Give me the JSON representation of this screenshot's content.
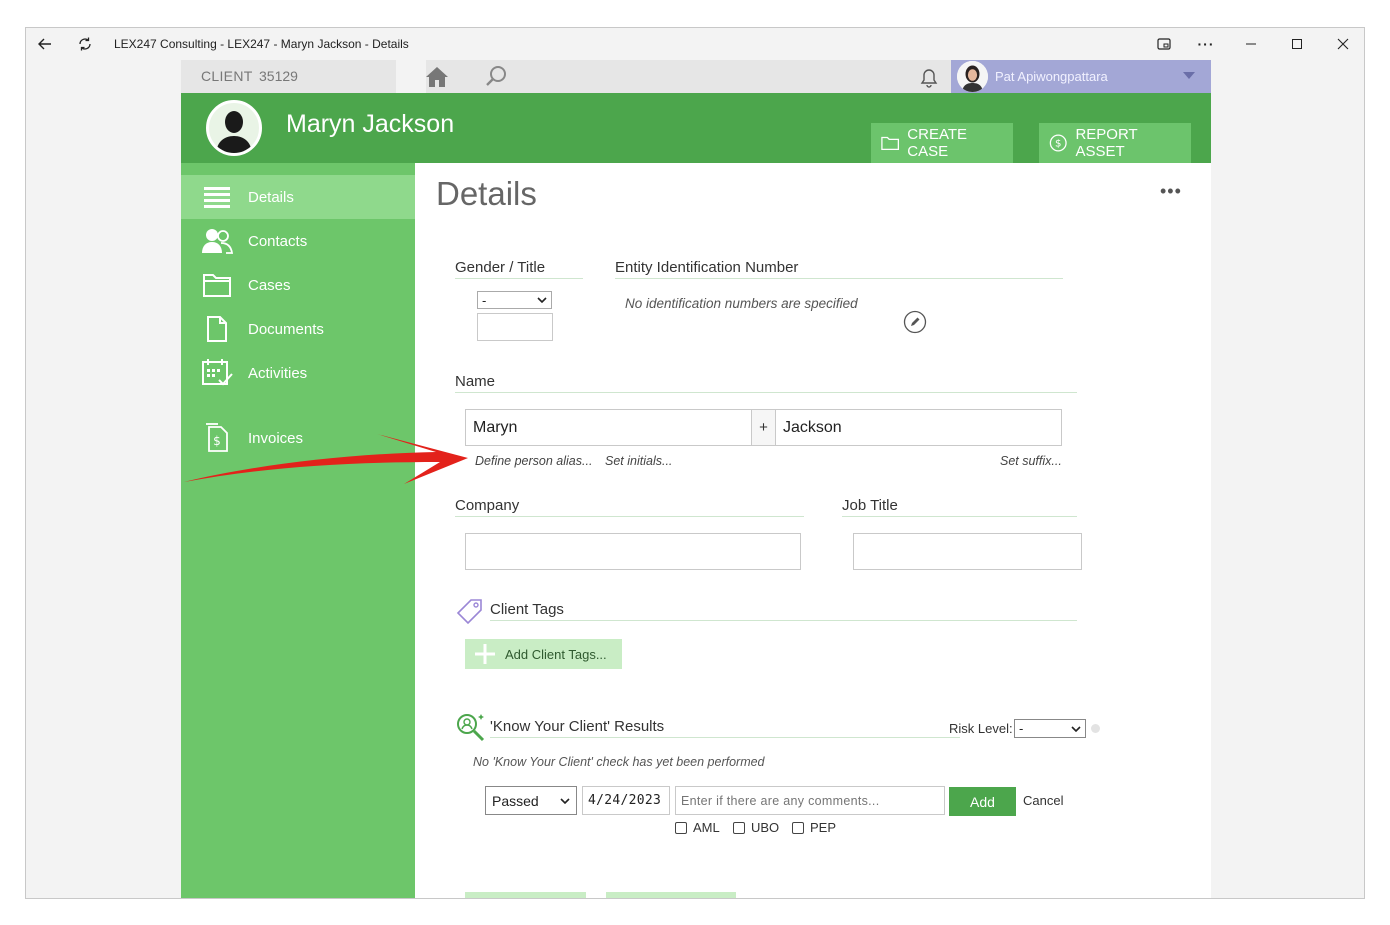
{
  "window": {
    "title": "LEX247 Consulting - LEX247 - Maryn Jackson - Details"
  },
  "topbar": {
    "client_label": "CLIENT",
    "client_id": "35129",
    "user_name": "Pat Apiwongpattara"
  },
  "header": {
    "client_name": "Maryn Jackson",
    "create_case_label": "CREATE CASE",
    "report_asset_label": "REPORT ASSET",
    "accent": "#4ca64c"
  },
  "sidebar": {
    "items": [
      {
        "label": "Details",
        "icon": "list-icon",
        "active": true
      },
      {
        "label": "Contacts",
        "icon": "contacts-icon"
      },
      {
        "label": "Cases",
        "icon": "folder-icon"
      },
      {
        "label": "Documents",
        "icon": "document-icon"
      },
      {
        "label": "Activities",
        "icon": "calendar-check-icon"
      },
      {
        "label": "Invoices",
        "icon": "invoice-icon"
      }
    ]
  },
  "main": {
    "title": "Details",
    "gender": {
      "label": "Gender / Title",
      "selected": "-"
    },
    "entity_id": {
      "label": "Entity Identification Number",
      "empty_note": "No identification numbers are specified"
    },
    "name": {
      "label": "Name",
      "first": "Maryn",
      "joiner": "+",
      "last": "Jackson",
      "alias_link": "Define person alias...",
      "initials_link": "Set initials...",
      "suffix_link": "Set suffix..."
    },
    "company": {
      "label": "Company",
      "value": ""
    },
    "job_title": {
      "label": "Job Title",
      "value": ""
    },
    "tags": {
      "label": "Client Tags",
      "add_label": "Add Client Tags..."
    },
    "kyc": {
      "label": "'Know Your Client' Results",
      "risk_label": "Risk Level:",
      "risk_selected": "-",
      "empty_note": "No 'Know Your Client' check has yet been performed",
      "status_selected": "Passed",
      "date": "4/24/2023",
      "comment_placeholder": "Enter if there are any comments...",
      "add_label": "Add",
      "cancel_label": "Cancel",
      "checks": [
        "AML",
        "UBO",
        "PEP"
      ]
    }
  },
  "colors": {
    "sidebar": "#6dc66a",
    "sidebar_active": "#8fd98c",
    "annotation_arrow": "#e3221b"
  }
}
